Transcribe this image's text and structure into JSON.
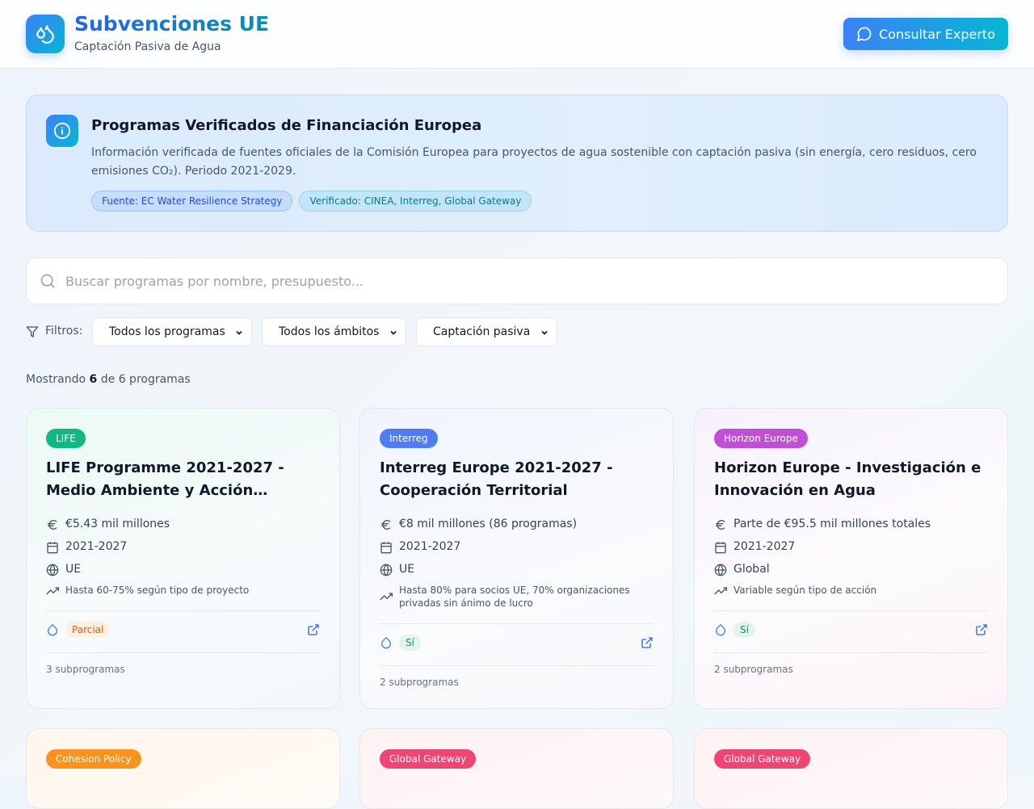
{
  "header": {
    "title": "Subvenciones UE",
    "subtitle": "Captación Pasiva de Agua",
    "cta_label": "Consultar Experto"
  },
  "info": {
    "title": "Programas Verificados de Financiación Europea",
    "text": "Información verificada de fuentes oficiales de la Comisión Europea para proyectos de agua sostenible con captación pasiva (sin energía, cero residuos, cero emisiones CO₂). Periodo 2021-2029.",
    "tags": [
      "Fuente: EC Water Resilience Strategy",
      "Verificado: CINEA, Interreg, Global Gateway"
    ]
  },
  "search": {
    "placeholder": "Buscar programas por nombre, presupuesto..."
  },
  "filters": {
    "label": "Filtros:",
    "program": "Todos los programas",
    "scope": "Todos los ámbitos",
    "capture": "Captación pasiva"
  },
  "results": {
    "prefix": "Mostrando",
    "shown": "6",
    "middle": "de 6 programas"
  },
  "cards": [
    {
      "badge": "LIFE",
      "badge_color": "#10b981",
      "title": "LIFE Programme 2021-2027 - Medio Ambiente y Acción…",
      "budget": "€5.43 mil millones",
      "period": "2021-2027",
      "scope": "UE",
      "cofinancing": "Hasta 60-75% según tipo de proyecto",
      "passive": "Parcial",
      "subprograms": "3 subprogramas"
    },
    {
      "badge": "Interreg",
      "badge_color": "#4f7cf0",
      "title": "Interreg Europe 2021-2027 - Cooperación Territorial",
      "budget": "€8 mil millones (86 programas)",
      "period": "2021-2027",
      "scope": "UE",
      "cofinancing": "Hasta 80% para socios UE, 70% organizaciones privadas sin ánimo de lucro",
      "passive": "Sí",
      "subprograms": "2 subprogramas"
    },
    {
      "badge": "Horizon Europe",
      "badge_color": "#c04fd6",
      "title": "Horizon Europe - Investigación e Innovación en Agua",
      "budget": "Parte de €95.5 mil millones totales",
      "period": "2021-2027",
      "scope": "Global",
      "cofinancing": "Variable según tipo de acción",
      "passive": "Sí",
      "subprograms": "2 subprogramas"
    },
    {
      "badge": "Cohesion Policy",
      "badge_color": "#f7931e"
    },
    {
      "badge": "Global Gateway",
      "badge_color": "#ec4673"
    },
    {
      "badge": "Global Gateway",
      "badge_color": "#ec4673"
    }
  ]
}
